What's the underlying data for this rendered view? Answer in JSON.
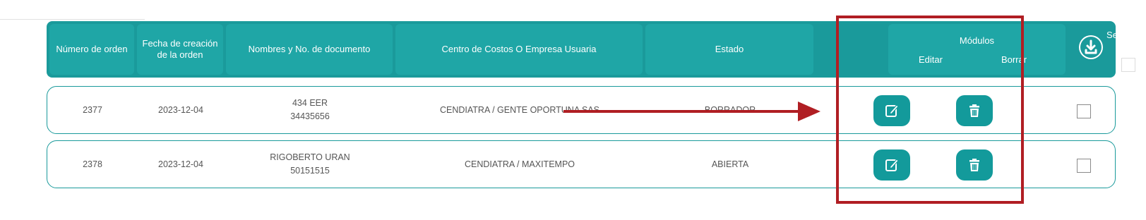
{
  "header": {
    "order_number": "Número de orden",
    "creation_date": "Fecha de creación de la orden",
    "names_doc": "Nombres y No. de documento",
    "cost_center": "Centro de Costos O Empresa Usuaria",
    "status": "Estado",
    "modules": "Módulos",
    "edit": "Editar",
    "delete": "Borrar",
    "select_all": "Seleccionar todo"
  },
  "rows": [
    {
      "order_number": "2377",
      "date": "2023-12-04",
      "name": "434 EER",
      "document": "34435656",
      "cost_center": "CENDIATRA / GENTE OPORTUNA SAS",
      "status": "BORRADOR"
    },
    {
      "order_number": "2378",
      "date": "2023-12-04",
      "name": "RIGOBERTO URAN",
      "document": "50151515",
      "cost_center": "CENDIATRA / MAXITEMPO",
      "status": "ABIERTA"
    }
  ],
  "icons": {
    "download": "download-icon",
    "edit": "edit-icon",
    "delete": "trash-icon"
  },
  "colors": {
    "teal_header": "#1a9a9b",
    "teal_button": "#139a9b",
    "annotation_red": "#b01e23"
  }
}
